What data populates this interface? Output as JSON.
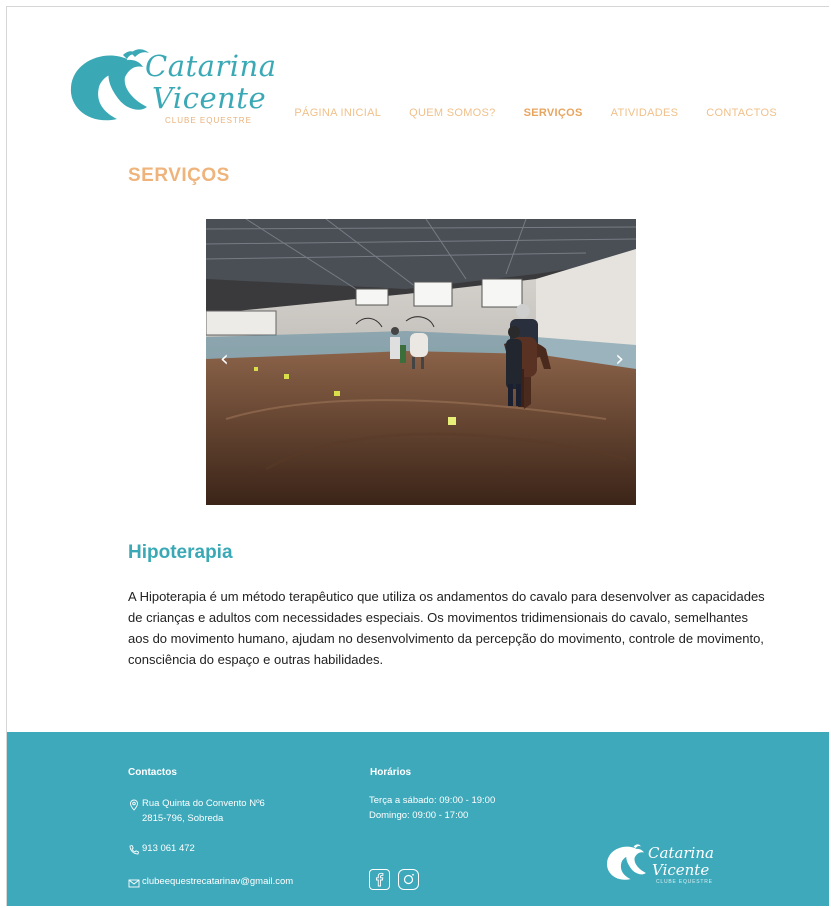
{
  "brand": {
    "name_line1": "Catarina",
    "name_line2": "Vicente",
    "tagline": "CLUBE EQUESTRE",
    "color_primary": "#3aa9b5",
    "color_accent": "#efb47c"
  },
  "nav": {
    "items": [
      {
        "label": "PÁGINA INICIAL",
        "active": false
      },
      {
        "label": "QUEM SOMOS?",
        "active": false
      },
      {
        "label": "SERVIÇOS",
        "active": true
      },
      {
        "label": "ATIVIDADES",
        "active": false
      },
      {
        "label": "CONTACTOS",
        "active": false
      }
    ]
  },
  "page": {
    "title": "SERVIÇOS"
  },
  "carousel": {
    "prev_icon": "chevron-left-icon",
    "next_icon": "chevron-right-icon",
    "prev_glyph": "‹",
    "next_glyph": "›"
  },
  "service": {
    "title": "Hipoterapia",
    "description": "A Hipoterapia é um método terapêutico que utiliza os andamentos do cavalo para desenvolver as capacidades de crianças e adultos com necessidades especiais. Os movimentos tridimensionais do cavalo, semelhantes aos do movimento humano, ajudam no desenvolvimento da percepção do movimento, controle de movimento, consciência do espaço e outras habilidades."
  },
  "footer": {
    "contacts_title": "Contactos",
    "address_line1": "Rua Quinta do Convento Nº6",
    "address_line2": "2815-796, Sobreda",
    "phone": "913 061 472",
    "email": "clubeequestrecatarinav@gmail.com",
    "hours_title": "Horários",
    "hours_line1": "Terça a sábado: 09:00 - 19:00",
    "hours_line2": "Domingo: 09:00 - 17:00",
    "social": [
      "facebook-icon",
      "instagram-icon"
    ],
    "logo_line1": "Catarina",
    "logo_line2": "Vicente",
    "logo_tagline": "CLUBE EQUESTRE"
  }
}
